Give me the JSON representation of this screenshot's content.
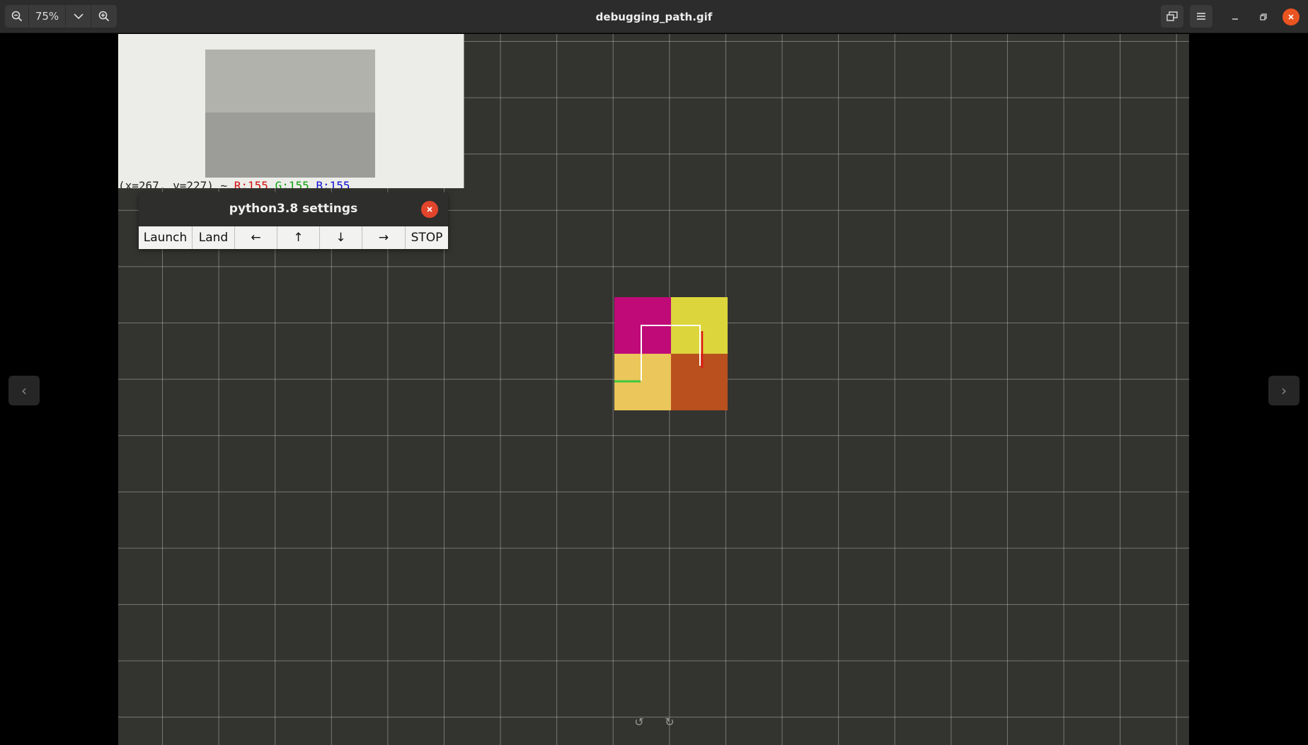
{
  "app": {
    "title": "debugging_path.gif",
    "zoom_level": "75%"
  },
  "header": {
    "zoom_out_icon": "zoom-out-icon",
    "zoom_menu_icon": "chevron-down-icon",
    "zoom_in_icon": "zoom-in-icon",
    "fullscreen_icon": "fullscreen-icon",
    "menu_icon": "hamburger-menu-icon",
    "minimize_icon": "minimize-icon",
    "restore_icon": "restore-icon",
    "close_icon": "close-icon"
  },
  "camera": {
    "readout_coords": "(x=267, y=227) ~",
    "readout_r": "R:155",
    "readout_g": "G:155",
    "readout_b": "B:155"
  },
  "settings": {
    "title": "python3.8 settings",
    "buttons": [
      "Launch",
      "Land",
      "←",
      "↑",
      "↓",
      "→",
      "STOP"
    ]
  },
  "tiles": {
    "colors": [
      "#bf0a78",
      "#dcd63c",
      "#ebc65a",
      "#b9501e"
    ]
  },
  "nav": {
    "prev": "‹",
    "next": "›"
  },
  "rotate": {
    "left": "↺",
    "right": "↻"
  }
}
